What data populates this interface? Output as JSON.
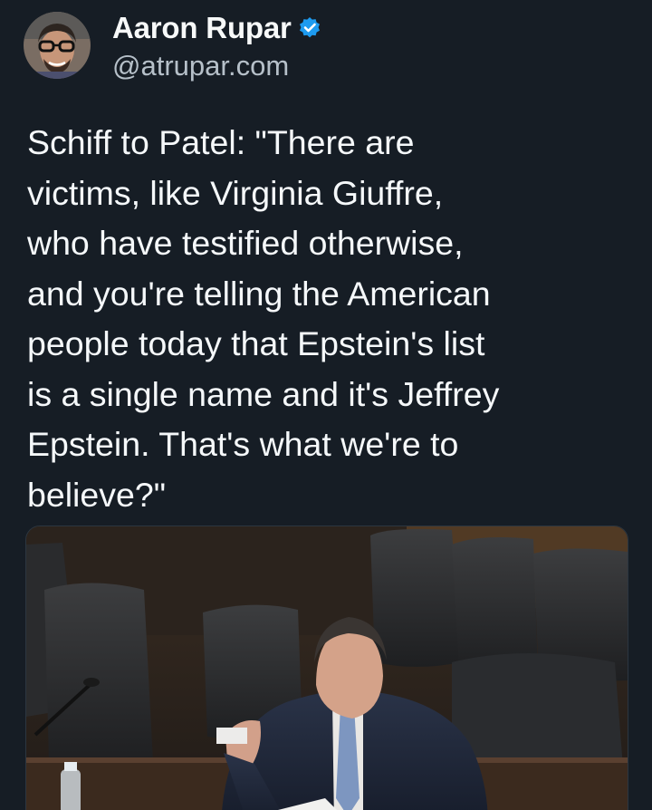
{
  "post": {
    "author": {
      "display_name": "Aaron Rupar",
      "handle": "@atrupar.com",
      "verified": true,
      "verified_icon": "verified-badge-icon",
      "verified_color": "#1d9bf0"
    },
    "text": "Schiff to Patel: \"There are\nvictims, like Virginia Giuffre,\nwho have testified otherwise,\nand you're telling the American\npeople today that Epstein's list\nis a single name and it's Jeffrey\nEpstein. That's what we're to\nbelieve?\"",
    "media": {
      "kind": "video-still"
    }
  },
  "theme": {
    "background": "#161d25",
    "text": "#f5f8fa",
    "secondary_text": "#b6c0c9"
  }
}
